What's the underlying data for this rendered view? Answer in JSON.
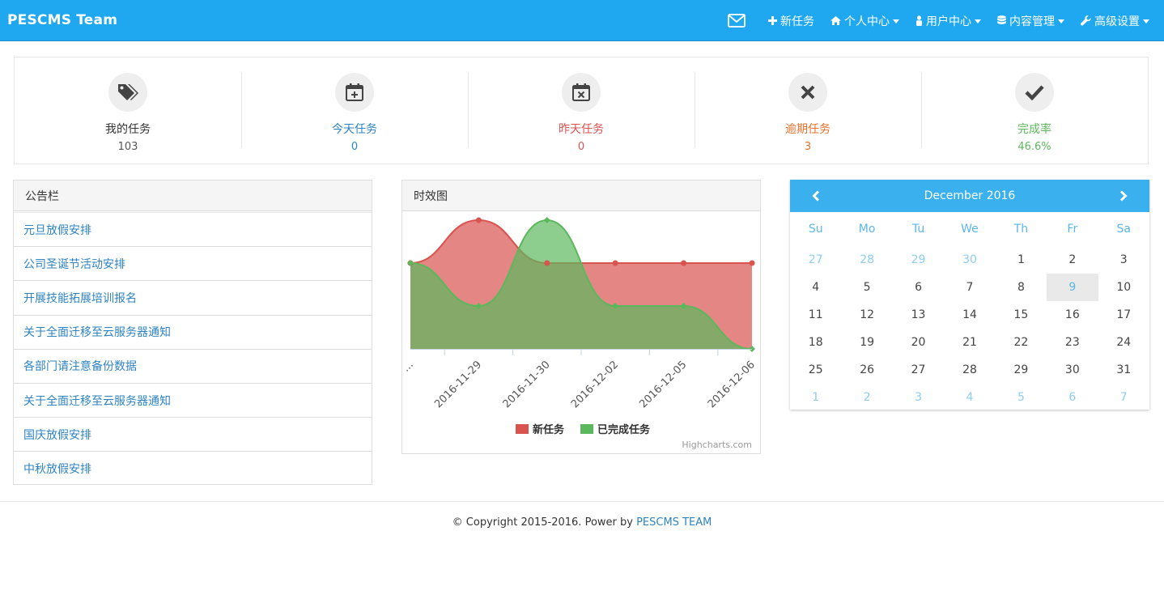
{
  "navbar": {
    "brand": "PESCMS Team",
    "items": [
      {
        "label": "新任务",
        "icon": "plus-icon",
        "dropdown": false
      },
      {
        "label": "个人中心",
        "icon": "home-icon",
        "dropdown": true
      },
      {
        "label": "用户中心",
        "icon": "user-icon",
        "dropdown": true
      },
      {
        "label": "内容管理",
        "icon": "database-icon",
        "dropdown": true
      },
      {
        "label": "高级设置",
        "icon": "wrench-icon",
        "dropdown": true
      }
    ],
    "mail_icon": "envelope-icon"
  },
  "stats": [
    {
      "label": "我的任务",
      "value": "103",
      "icon": "tags-icon",
      "color": "#333333"
    },
    {
      "label": "今天任务",
      "value": "0",
      "icon": "calendar-plus-icon",
      "color": "#2e83c1"
    },
    {
      "label": "昨天任务",
      "value": "0",
      "icon": "calendar-times-icon",
      "color": "#d9534f"
    },
    {
      "label": "逾期任务",
      "value": "3",
      "icon": "times-icon",
      "color": "#e8702a"
    },
    {
      "label": "完成率",
      "value": "46.6%",
      "icon": "check-icon",
      "color": "#5cb85c"
    }
  ],
  "notice": {
    "title": "公告栏",
    "items": [
      "元旦放假安排",
      "公司圣诞节活动安排",
      "开展技能拓展培训报名",
      "关于全面迁移至云服务器通知",
      "各部门请注意备份数据",
      "关于全面迁移至云服务器通知",
      "国庆放假安排",
      "中秋放假安排"
    ]
  },
  "chart_panel": {
    "title": "时效图",
    "credit": "Highcharts.com"
  },
  "chart_data": {
    "type": "area",
    "categories": [
      "...",
      "2016-11-29",
      "2016-11-30",
      "2016-12-02",
      "2016-12-05",
      "2016-12-06"
    ],
    "series": [
      {
        "name": "新任务",
        "values": [
          2,
          3,
          2,
          2,
          2,
          2
        ],
        "color": "#d9534f"
      },
      {
        "name": "已完成任务",
        "values": [
          2,
          1,
          3,
          1,
          1,
          0
        ],
        "color": "#5cb85c"
      }
    ],
    "ylim": [
      0,
      3
    ],
    "grid": false,
    "legend": "bottom-center",
    "smooth": true
  },
  "calendar": {
    "month_label": "December 2016",
    "weekdays": [
      "Su",
      "Mo",
      "Tu",
      "We",
      "Th",
      "Fr",
      "Sa"
    ],
    "days": [
      {
        "d": "27",
        "muted": true
      },
      {
        "d": "28",
        "muted": true
      },
      {
        "d": "29",
        "muted": true
      },
      {
        "d": "30",
        "muted": true
      },
      {
        "d": "1"
      },
      {
        "d": "2"
      },
      {
        "d": "3"
      },
      {
        "d": "4"
      },
      {
        "d": "5"
      },
      {
        "d": "6"
      },
      {
        "d": "7"
      },
      {
        "d": "8"
      },
      {
        "d": "9",
        "today": true
      },
      {
        "d": "10"
      },
      {
        "d": "11"
      },
      {
        "d": "12"
      },
      {
        "d": "13"
      },
      {
        "d": "14"
      },
      {
        "d": "15"
      },
      {
        "d": "16"
      },
      {
        "d": "17"
      },
      {
        "d": "18"
      },
      {
        "d": "19"
      },
      {
        "d": "20"
      },
      {
        "d": "21"
      },
      {
        "d": "22"
      },
      {
        "d": "23"
      },
      {
        "d": "24"
      },
      {
        "d": "25"
      },
      {
        "d": "26"
      },
      {
        "d": "27"
      },
      {
        "d": "28"
      },
      {
        "d": "29"
      },
      {
        "d": "30"
      },
      {
        "d": "31"
      },
      {
        "d": "1",
        "muted": true
      },
      {
        "d": "2",
        "muted": true
      },
      {
        "d": "3",
        "muted": true
      },
      {
        "d": "4",
        "muted": true
      },
      {
        "d": "5",
        "muted": true
      },
      {
        "d": "6",
        "muted": true
      },
      {
        "d": "7",
        "muted": true
      }
    ]
  },
  "footer": {
    "text": "© Copyright 2015-2016. Power by ",
    "link": "PESCMS TEAM"
  }
}
